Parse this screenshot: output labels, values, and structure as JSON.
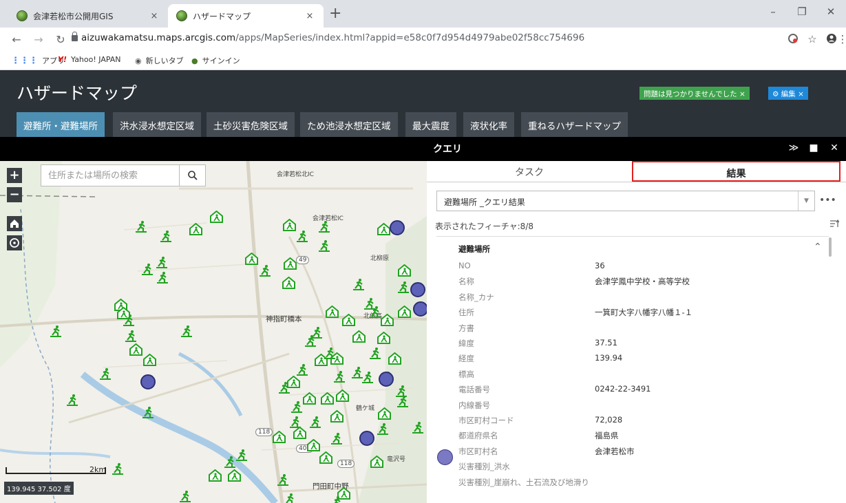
{
  "browser": {
    "tabs": [
      {
        "title": "会津若松市公開用GIS",
        "close": "×"
      },
      {
        "title": "ハザードマップ",
        "close": "×"
      }
    ],
    "new_tab": "+",
    "window_controls": {
      "minimize": "–",
      "restore": "❐",
      "close": "✕"
    },
    "nav": {
      "back": "←",
      "forward": "→",
      "reload": "↻"
    },
    "url_host": "aizuwakamatsu.maps.arcgis.com",
    "url_rest": "/apps/MapSeries/index.html?appid=e58c0f7d954d4979abe02f58cc754696",
    "right_icons": {
      "star": "☆",
      "menu": "⋮"
    },
    "bookmarks": [
      {
        "icon": "apps-grid-icon",
        "label": "アプリ"
      },
      {
        "icon": "yahoo-icon",
        "label": "Yahoo! JAPAN"
      },
      {
        "icon": "globe-icon",
        "label": "新しいタブ"
      },
      {
        "icon": "gis-icon",
        "label": "サインイン"
      }
    ]
  },
  "app": {
    "title": "ハザードマップ",
    "badge_issues": "問題は見つかりませんでした ×",
    "badge_edit": "⚙ 編集 ×",
    "tabs": [
      "避難所・避難場所",
      "洪水浸水想定区域",
      "土砂災害危険区域",
      "ため池浸水想定区域",
      "最大震度",
      "液状化率",
      "重ねるハザードマップ"
    ]
  },
  "map": {
    "search_placeholder": "住所または場所の検索",
    "zoom_in": "+",
    "zoom_out": "−",
    "scale_label": "2km",
    "coordinates": "139.945 37.502 度",
    "labels": {
      "ic_north": "会津若松北IC",
      "ic": "会津若松IC",
      "kanzashi": "神指町橋本",
      "kitayanagihara": "北柳原",
      "kitayamagahara": "北俵高",
      "tsurugajo": "鶴ケ城",
      "monden": "門田町中野",
      "takizawa": "竜沢号",
      "route_49": "49",
      "route_118a": "118",
      "route_118b": "118",
      "route_401": "401"
    }
  },
  "panel": {
    "title": "クエリ",
    "icons": {
      "collapse": "≫",
      "maximize": "■",
      "close": "✕"
    },
    "tab_task": "タスク",
    "tab_result": "結果",
    "select_value": "避難場所 _クエリ結果",
    "more": "•••",
    "feature_count": "表示されたフィーチャ:8/8",
    "record_title": "避難場所",
    "fields": [
      {
        "name": "NO",
        "value": "36"
      },
      {
        "name": "名称",
        "value": "会津学鳳中学校・高等学校"
      },
      {
        "name": "名称_カナ",
        "value": ""
      },
      {
        "name": "住所",
        "value": "一箕町大字八幡字八幡１-１"
      },
      {
        "name": "方書",
        "value": ""
      },
      {
        "name": "緯度",
        "value": "37.51"
      },
      {
        "name": "経度",
        "value": "139.94"
      },
      {
        "name": "標高",
        "value": ""
      },
      {
        "name": "電話番号",
        "value": "0242-22-3491"
      },
      {
        "name": "内線番号",
        "value": ""
      },
      {
        "name": "市区町村コード",
        "value": "72,028"
      },
      {
        "name": "都道府県名",
        "value": "福島県"
      },
      {
        "name": "市区町村名",
        "value": "会津若松市"
      },
      {
        "name": "災害種別_洪水",
        "value": ""
      },
      {
        "name": "災害種別_崖崩れ、土石流及び地滑り",
        "value": ""
      }
    ]
  },
  "colors": {
    "accent_tab": "#4d8fb2",
    "header": "#2b3238",
    "badge_ok": "#3fa34d",
    "badge_edit": "#1e88d9",
    "highlight": "#e02020",
    "marker_green": "#21a321",
    "pin": "#5d62b8"
  }
}
